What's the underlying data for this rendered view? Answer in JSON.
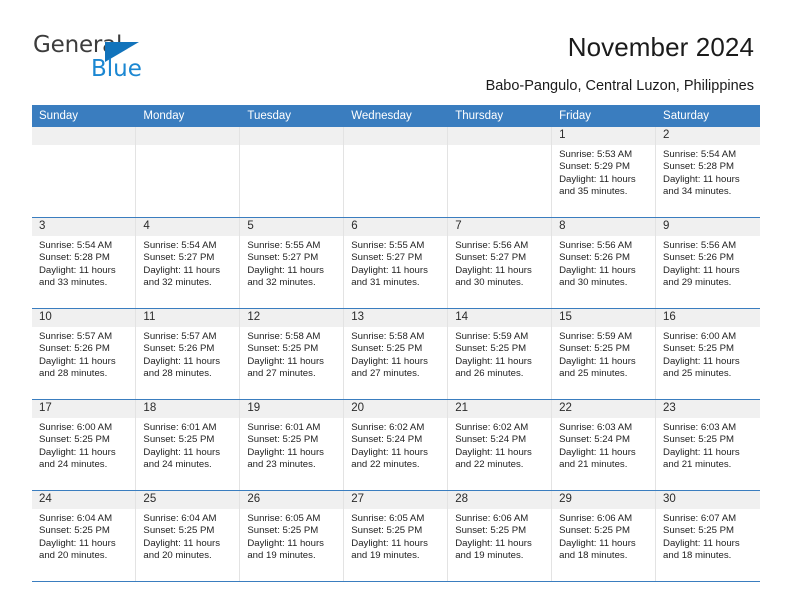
{
  "brand": {
    "name_top": "General",
    "name_bottom": "Blue",
    "triangle_color": "#1273bb",
    "blue_color": "#1b87d2"
  },
  "header": {
    "title": "November 2024",
    "subtitle": "Babo-Pangulo, Central Luzon, Philippines",
    "accent_color": "#3a7dbf",
    "band_color": "#f0f0f0"
  },
  "calendar": {
    "weekday_headers": [
      "Sunday",
      "Monday",
      "Tuesday",
      "Wednesday",
      "Thursday",
      "Friday",
      "Saturday"
    ],
    "weeks": [
      [
        {
          "day": "",
          "empty": true
        },
        {
          "day": "",
          "empty": true
        },
        {
          "day": "",
          "empty": true
        },
        {
          "day": "",
          "empty": true
        },
        {
          "day": "",
          "empty": true
        },
        {
          "day": "1",
          "sunrise": "Sunrise: 5:53 AM",
          "sunset": "Sunset: 5:29 PM",
          "daylight": "Daylight: 11 hours and 35 minutes."
        },
        {
          "day": "2",
          "sunrise": "Sunrise: 5:54 AM",
          "sunset": "Sunset: 5:28 PM",
          "daylight": "Daylight: 11 hours and 34 minutes."
        }
      ],
      [
        {
          "day": "3",
          "sunrise": "Sunrise: 5:54 AM",
          "sunset": "Sunset: 5:28 PM",
          "daylight": "Daylight: 11 hours and 33 minutes."
        },
        {
          "day": "4",
          "sunrise": "Sunrise: 5:54 AM",
          "sunset": "Sunset: 5:27 PM",
          "daylight": "Daylight: 11 hours and 32 minutes."
        },
        {
          "day": "5",
          "sunrise": "Sunrise: 5:55 AM",
          "sunset": "Sunset: 5:27 PM",
          "daylight": "Daylight: 11 hours and 32 minutes."
        },
        {
          "day": "6",
          "sunrise": "Sunrise: 5:55 AM",
          "sunset": "Sunset: 5:27 PM",
          "daylight": "Daylight: 11 hours and 31 minutes."
        },
        {
          "day": "7",
          "sunrise": "Sunrise: 5:56 AM",
          "sunset": "Sunset: 5:27 PM",
          "daylight": "Daylight: 11 hours and 30 minutes."
        },
        {
          "day": "8",
          "sunrise": "Sunrise: 5:56 AM",
          "sunset": "Sunset: 5:26 PM",
          "daylight": "Daylight: 11 hours and 30 minutes."
        },
        {
          "day": "9",
          "sunrise": "Sunrise: 5:56 AM",
          "sunset": "Sunset: 5:26 PM",
          "daylight": "Daylight: 11 hours and 29 minutes."
        }
      ],
      [
        {
          "day": "10",
          "sunrise": "Sunrise: 5:57 AM",
          "sunset": "Sunset: 5:26 PM",
          "daylight": "Daylight: 11 hours and 28 minutes."
        },
        {
          "day": "11",
          "sunrise": "Sunrise: 5:57 AM",
          "sunset": "Sunset: 5:26 PM",
          "daylight": "Daylight: 11 hours and 28 minutes."
        },
        {
          "day": "12",
          "sunrise": "Sunrise: 5:58 AM",
          "sunset": "Sunset: 5:25 PM",
          "daylight": "Daylight: 11 hours and 27 minutes."
        },
        {
          "day": "13",
          "sunrise": "Sunrise: 5:58 AM",
          "sunset": "Sunset: 5:25 PM",
          "daylight": "Daylight: 11 hours and 27 minutes."
        },
        {
          "day": "14",
          "sunrise": "Sunrise: 5:59 AM",
          "sunset": "Sunset: 5:25 PM",
          "daylight": "Daylight: 11 hours and 26 minutes."
        },
        {
          "day": "15",
          "sunrise": "Sunrise: 5:59 AM",
          "sunset": "Sunset: 5:25 PM",
          "daylight": "Daylight: 11 hours and 25 minutes."
        },
        {
          "day": "16",
          "sunrise": "Sunrise: 6:00 AM",
          "sunset": "Sunset: 5:25 PM",
          "daylight": "Daylight: 11 hours and 25 minutes."
        }
      ],
      [
        {
          "day": "17",
          "sunrise": "Sunrise: 6:00 AM",
          "sunset": "Sunset: 5:25 PM",
          "daylight": "Daylight: 11 hours and 24 minutes."
        },
        {
          "day": "18",
          "sunrise": "Sunrise: 6:01 AM",
          "sunset": "Sunset: 5:25 PM",
          "daylight": "Daylight: 11 hours and 24 minutes."
        },
        {
          "day": "19",
          "sunrise": "Sunrise: 6:01 AM",
          "sunset": "Sunset: 5:25 PM",
          "daylight": "Daylight: 11 hours and 23 minutes."
        },
        {
          "day": "20",
          "sunrise": "Sunrise: 6:02 AM",
          "sunset": "Sunset: 5:24 PM",
          "daylight": "Daylight: 11 hours and 22 minutes."
        },
        {
          "day": "21",
          "sunrise": "Sunrise: 6:02 AM",
          "sunset": "Sunset: 5:24 PM",
          "daylight": "Daylight: 11 hours and 22 minutes."
        },
        {
          "day": "22",
          "sunrise": "Sunrise: 6:03 AM",
          "sunset": "Sunset: 5:24 PM",
          "daylight": "Daylight: 11 hours and 21 minutes."
        },
        {
          "day": "23",
          "sunrise": "Sunrise: 6:03 AM",
          "sunset": "Sunset: 5:25 PM",
          "daylight": "Daylight: 11 hours and 21 minutes."
        }
      ],
      [
        {
          "day": "24",
          "sunrise": "Sunrise: 6:04 AM",
          "sunset": "Sunset: 5:25 PM",
          "daylight": "Daylight: 11 hours and 20 minutes."
        },
        {
          "day": "25",
          "sunrise": "Sunrise: 6:04 AM",
          "sunset": "Sunset: 5:25 PM",
          "daylight": "Daylight: 11 hours and 20 minutes."
        },
        {
          "day": "26",
          "sunrise": "Sunrise: 6:05 AM",
          "sunset": "Sunset: 5:25 PM",
          "daylight": "Daylight: 11 hours and 19 minutes."
        },
        {
          "day": "27",
          "sunrise": "Sunrise: 6:05 AM",
          "sunset": "Sunset: 5:25 PM",
          "daylight": "Daylight: 11 hours and 19 minutes."
        },
        {
          "day": "28",
          "sunrise": "Sunrise: 6:06 AM",
          "sunset": "Sunset: 5:25 PM",
          "daylight": "Daylight: 11 hours and 19 minutes."
        },
        {
          "day": "29",
          "sunrise": "Sunrise: 6:06 AM",
          "sunset": "Sunset: 5:25 PM",
          "daylight": "Daylight: 11 hours and 18 minutes."
        },
        {
          "day": "30",
          "sunrise": "Sunrise: 6:07 AM",
          "sunset": "Sunset: 5:25 PM",
          "daylight": "Daylight: 11 hours and 18 minutes."
        }
      ]
    ]
  }
}
